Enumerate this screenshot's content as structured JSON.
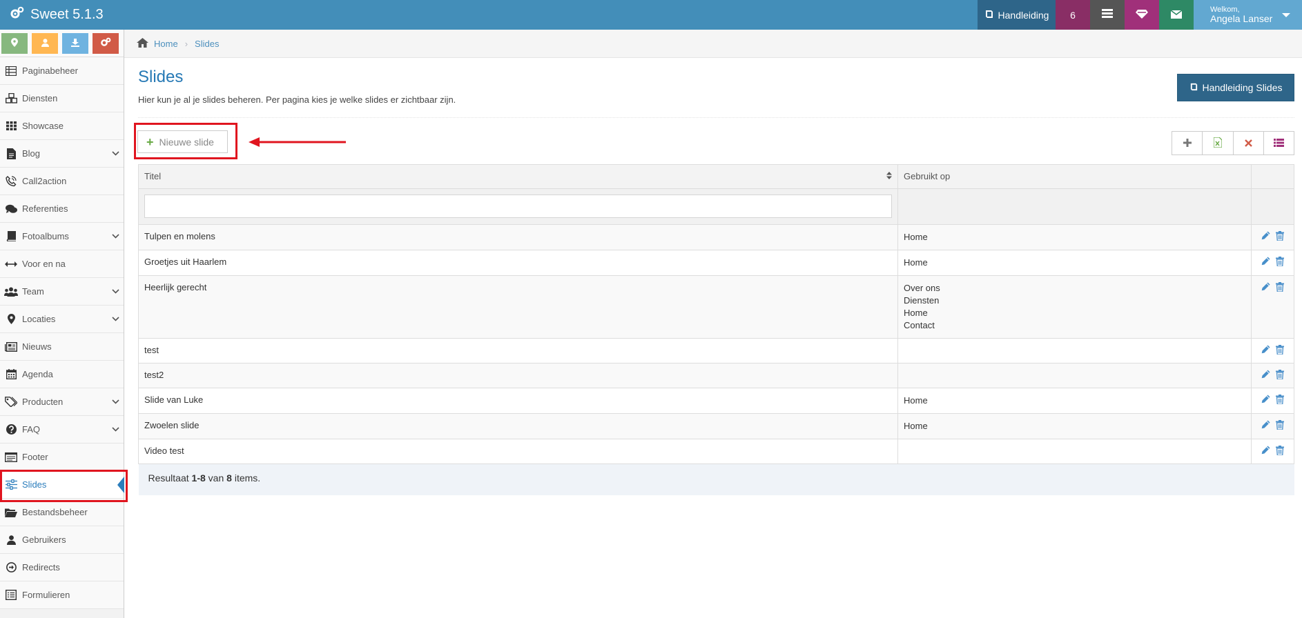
{
  "app": {
    "title": "Sweet 5.1.3"
  },
  "topbar": {
    "manual_label": "Handleiding",
    "count": "6",
    "user": {
      "welcome": "Welkom,",
      "name": "Angela Lanser"
    },
    "icons": [
      "book-icon",
      "list-icon",
      "diamond-icon",
      "envelope-icon"
    ]
  },
  "sidebar": {
    "shortcuts": [
      "map-marker-icon",
      "user-icon",
      "download-icon",
      "cogs-icon"
    ],
    "items": [
      {
        "label": "Paginabeheer",
        "icon": "table-icon",
        "submenu": false
      },
      {
        "label": "Diensten",
        "icon": "cubes-icon",
        "submenu": false
      },
      {
        "label": "Showcase",
        "icon": "grid-icon",
        "submenu": false
      },
      {
        "label": "Blog",
        "icon": "file-icon",
        "submenu": true
      },
      {
        "label": "Call2action",
        "icon": "phone-icon",
        "submenu": false
      },
      {
        "label": "Referenties",
        "icon": "comments-icon",
        "submenu": false
      },
      {
        "label": "Fotoalbums",
        "icon": "book-icon",
        "submenu": true
      },
      {
        "label": "Voor en na",
        "icon": "arrows-h-icon",
        "submenu": false
      },
      {
        "label": "Team",
        "icon": "users-icon",
        "submenu": true
      },
      {
        "label": "Locaties",
        "icon": "map-marker-icon",
        "submenu": true
      },
      {
        "label": "Nieuws",
        "icon": "newspaper-icon",
        "submenu": false
      },
      {
        "label": "Agenda",
        "icon": "calendar-icon",
        "submenu": false
      },
      {
        "label": "Producten",
        "icon": "tags-icon",
        "submenu": true
      },
      {
        "label": "FAQ",
        "icon": "question-icon",
        "submenu": true
      },
      {
        "label": "Footer",
        "icon": "footer-icon",
        "submenu": false
      },
      {
        "label": "Slides",
        "icon": "sliders-icon",
        "submenu": false,
        "active": true
      },
      {
        "label": "Bestandsbeheer",
        "icon": "folder-icon",
        "submenu": false
      },
      {
        "label": "Gebruikers",
        "icon": "user-icon",
        "submenu": false
      },
      {
        "label": "Redirects",
        "icon": "arrow-circle-icon",
        "submenu": false
      },
      {
        "label": "Formulieren",
        "icon": "form-icon",
        "submenu": false
      }
    ]
  },
  "breadcrumb": {
    "home": "Home",
    "current": "Slides"
  },
  "page": {
    "title": "Slides",
    "description": "Hier kun je al je slides beheren. Per pagina kies je welke slides er zichtbaar zijn.",
    "manual_button": "Handleiding Slides",
    "new_button": "Nieuwe slide",
    "toolbar": [
      "plus-icon",
      "excel-icon",
      "clear-filter-icon",
      "columns-icon"
    ]
  },
  "table": {
    "columns": [
      "Titel",
      "Gebruikt op",
      ""
    ],
    "filter_value": "",
    "rows": [
      {
        "titel": "Tulpen en molens",
        "gebruikt_op": [
          "Home"
        ]
      },
      {
        "titel": "Groetjes uit Haarlem",
        "gebruikt_op": [
          "Home"
        ]
      },
      {
        "titel": "Heerlijk gerecht",
        "gebruikt_op": [
          "Over ons",
          "Diensten",
          "Home",
          "Contact"
        ]
      },
      {
        "titel": "test",
        "gebruikt_op": []
      },
      {
        "titel": "test2",
        "gebruikt_op": []
      },
      {
        "titel": "Slide van Luke",
        "gebruikt_op": [
          "Home"
        ]
      },
      {
        "titel": "Zwoelen slide",
        "gebruikt_op": [
          "Home"
        ]
      },
      {
        "titel": "Video test",
        "gebruikt_op": []
      }
    ],
    "summary": {
      "prefix": "Resultaat ",
      "range": "1-8",
      "middle": " van ",
      "total": "8",
      "suffix": " items."
    }
  },
  "colors": {
    "topbar": "#438eb9",
    "highlight": "#e0151f",
    "link": "#2679b5",
    "edit": "#478fca",
    "delete": "#4a8fca"
  }
}
